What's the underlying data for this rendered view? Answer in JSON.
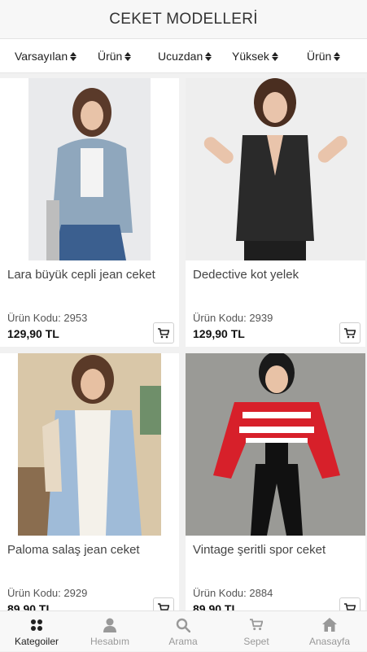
{
  "header": {
    "title": "CEKET MODELLERİ"
  },
  "sort": [
    {
      "label": "Varsayılan"
    },
    {
      "label": "Ürün"
    },
    {
      "label": "Ucuzdan"
    },
    {
      "label": "Yüksek"
    },
    {
      "label": "Ürün"
    }
  ],
  "products": [
    {
      "name": "Lara büyük cepli jean ceket",
      "code": "Ürün Kodu: 2953",
      "price": "129,90 TL",
      "bg": "#e9eaec",
      "garment": "#8fa7bd"
    },
    {
      "name": "Dedective kot yelek",
      "code": "Ürün Kodu: 2939",
      "price": "129,90 TL",
      "bg": "#eeeeee",
      "garment": "#2a2a2a"
    },
    {
      "name": "Paloma salaş jean ceket",
      "code": "Ürün Kodu: 2929",
      "price": "89,90 TL",
      "bg": "#d9c7a8",
      "garment": "#9fbbd8"
    },
    {
      "name": "Vintage şeritli spor ceket",
      "code": "Ürün Kodu: 2884",
      "price": "89,90 TL",
      "bg": "#9a9a96",
      "garment": "#d7202a"
    }
  ],
  "nav": [
    {
      "label": "Kategoiler",
      "icon": "grid-icon",
      "active": true
    },
    {
      "label": "Hesabım",
      "icon": "user-icon",
      "active": false
    },
    {
      "label": "Arama",
      "icon": "search-icon",
      "active": false
    },
    {
      "label": "Sepet",
      "icon": "cart-icon",
      "active": false
    },
    {
      "label": "Anasayfa",
      "icon": "home-icon",
      "active": false
    }
  ]
}
